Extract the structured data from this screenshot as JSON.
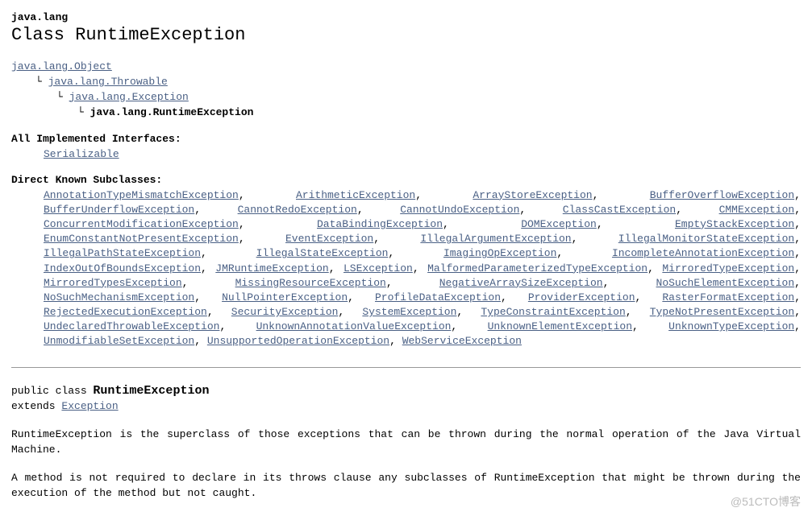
{
  "package": "java.lang",
  "classTitle": "Class RuntimeException",
  "inheritance": [
    {
      "text": "java.lang.Object",
      "link": true,
      "indent": 0
    },
    {
      "text": "java.lang.Throwable",
      "link": true,
      "indent": 1
    },
    {
      "text": "java.lang.Exception",
      "link": true,
      "indent": 2
    },
    {
      "text": "java.lang.RuntimeException",
      "link": false,
      "indent": 3
    }
  ],
  "interfacesLabel": "All Implemented Interfaces:",
  "interfaces": "Serializable",
  "subclassesLabel": "Direct Known Subclasses:",
  "subclasses": [
    "AnnotationTypeMismatchException",
    "ArithmeticException",
    "ArrayStoreException",
    "BufferOverflowException",
    "BufferUnderflowException",
    "CannotRedoException",
    "CannotUndoException",
    "ClassCastException",
    "CMMException",
    "ConcurrentModificationException",
    "DataBindingException",
    "DOMException",
    "EmptyStackException",
    "EnumConstantNotPresentException",
    "EventException",
    "IllegalArgumentException",
    "IllegalMonitorStateException",
    "IllegalPathStateException",
    "IllegalStateException",
    "ImagingOpException",
    "IncompleteAnnotationException",
    "IndexOutOfBoundsException",
    "JMRuntimeException",
    "LSException",
    "MalformedParameterizedTypeException",
    "MirroredTypeException",
    "MirroredTypesException",
    "MissingResourceException",
    "NegativeArraySizeException",
    "NoSuchElementException",
    "NoSuchMechanismException",
    "NullPointerException",
    "ProfileDataException",
    "ProviderException",
    "RasterFormatException",
    "RejectedExecutionException",
    "SecurityException",
    "SystemException",
    "TypeConstraintException",
    "TypeNotPresentException",
    "UndeclaredThrowableException",
    "UnknownAnnotationValueException",
    "UnknownElementException",
    "UnknownTypeException",
    "UnmodifiableSetException",
    "UnsupportedOperationException",
    "WebServiceException"
  ],
  "sigPublicClass": "public class ",
  "sigClassName": "RuntimeException",
  "sigExtends": "extends ",
  "sigSuperclass": "Exception",
  "desc1a": "RuntimeException",
  "desc1b": " is the superclass of those exceptions that can be thrown during the normal operation of the Java Virtual Machine.",
  "desc2a": "A method is not required to declare in its ",
  "desc2b": "throws",
  "desc2c": " clause any subclasses of ",
  "desc2d": "RuntimeException",
  "desc2e": " that might be thrown during the execution of the method but not caught.",
  "watermark": "@51CTO博客"
}
